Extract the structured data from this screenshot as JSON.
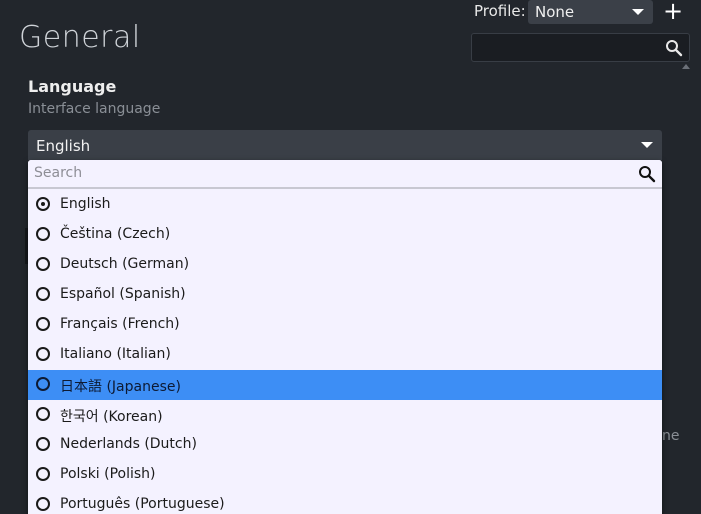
{
  "header": {
    "page_title": "General",
    "profile_label": "Profile:",
    "profile_value": "None",
    "add_label": "+",
    "search_placeholder": ""
  },
  "section": {
    "title": "Language",
    "subtitle": "Interface language",
    "selected_value": "English"
  },
  "background": {
    "right_clipped_text": "ne"
  },
  "dropdown": {
    "search_placeholder": "Search",
    "options": [
      {
        "label": "English",
        "checked": true,
        "hover": false
      },
      {
        "label": "Čeština (Czech)",
        "checked": false,
        "hover": false
      },
      {
        "label": "Deutsch (German)",
        "checked": false,
        "hover": false
      },
      {
        "label": "Español (Spanish)",
        "checked": false,
        "hover": false
      },
      {
        "label": "Français (French)",
        "checked": false,
        "hover": false
      },
      {
        "label": "Italiano (Italian)",
        "checked": false,
        "hover": false
      },
      {
        "label": "日本語 (Japanese)",
        "checked": false,
        "hover": true
      },
      {
        "label": "한국어 (Korean)",
        "checked": false,
        "hover": false
      },
      {
        "label": "Nederlands (Dutch)",
        "checked": false,
        "hover": false
      },
      {
        "label": "Polski (Polish)",
        "checked": false,
        "hover": false
      },
      {
        "label": "Português (Portuguese)",
        "checked": false,
        "hover": false
      }
    ]
  },
  "colors": {
    "background": "#22262c",
    "dropdown_bg": "#f4f2ff",
    "hover_highlight": "#3d8ef5",
    "select_bg": "#3a3f47"
  },
  "icons": {
    "search": "search-icon",
    "caret": "chevron-down-icon",
    "add": "plus-icon",
    "radio": "radio-icon"
  }
}
